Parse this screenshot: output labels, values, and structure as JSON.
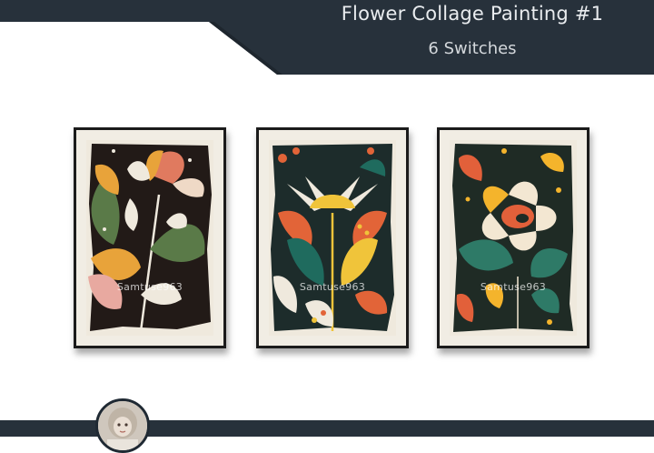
{
  "header": {
    "title": "Flower Collage Painting #1",
    "subtitle": "6 Switches",
    "banner_color": "#27313b"
  },
  "paintings": [
    {
      "watermark": "Samtuse963",
      "palette": [
        "#221a17",
        "#e8a33a",
        "#e07a5f",
        "#5a7a48",
        "#efe9dd"
      ]
    },
    {
      "watermark": "Samtuse963",
      "palette": [
        "#1d2c2b",
        "#e26438",
        "#1f6b5e",
        "#f0c43a",
        "#efe9dd"
      ]
    },
    {
      "watermark": "Samtuse963",
      "palette": [
        "#1f2b25",
        "#f4b42c",
        "#e2603a",
        "#2e7a67",
        "#f3e7d2"
      ]
    }
  ],
  "footer": {
    "avatar_icon": "doll-avatar-icon"
  }
}
